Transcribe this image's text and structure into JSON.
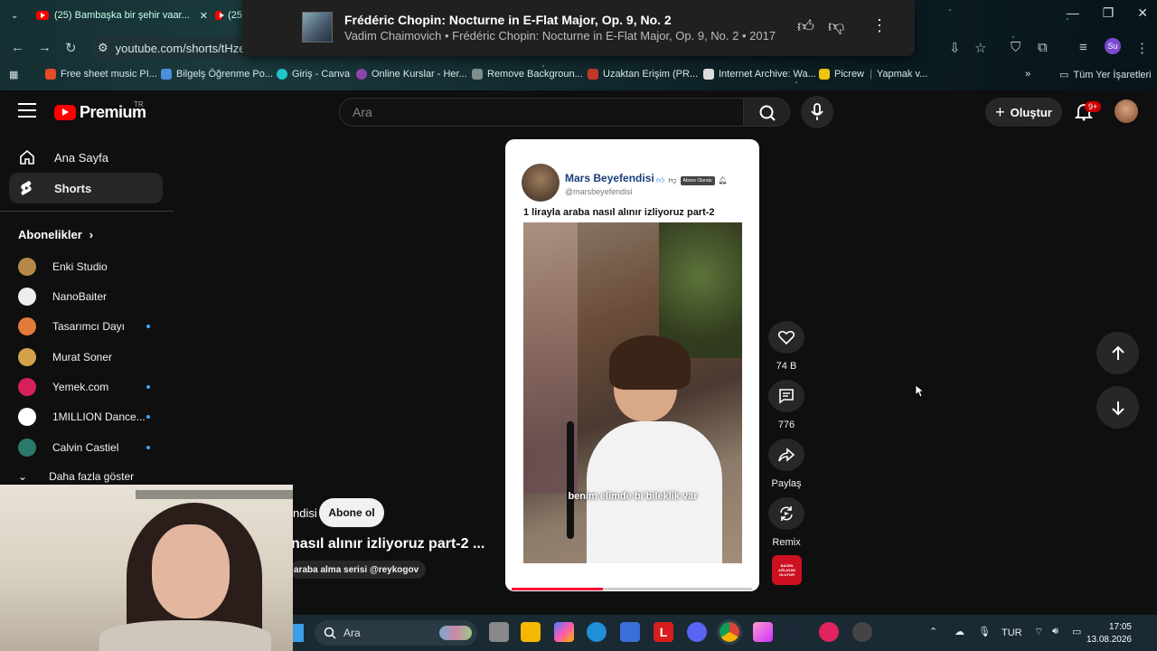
{
  "browser": {
    "tabs": [
      {
        "label": "(25) Bambaşka bir şehir vaar..."
      },
      {
        "label": "(25"
      }
    ],
    "address": "youtube.com/shorts/tHzeV",
    "profile_initials": "Su",
    "bookmarks": [
      {
        "label": "Free sheet music PI...",
        "color": "#e34c26"
      },
      {
        "label": "Bilgelş Öğrenme Po...",
        "color": "#4a90d9"
      },
      {
        "label": "Giriş - Canva",
        "color": "#20c4cb"
      },
      {
        "label": "Online Kurslar - Her...",
        "color": "#8e44ad"
      },
      {
        "label": "Remove Backgroun...",
        "color": "#7f8c8d"
      },
      {
        "label": "Uzaktan Erişim (PR...",
        "color": "#c0392b"
      },
      {
        "label": "Internet Archive: Wa...",
        "color": "#dddddd"
      },
      {
        "label": "Picrew",
        "color": "#f1c40f"
      },
      {
        "label": "Yapmak v...",
        "color": "#888888"
      }
    ],
    "all_bookmarks": "Tüm Yer İşaretleri"
  },
  "media": {
    "title": "Frédéric Chopin: Nocturne in E-Flat Major, Op. 9, No. 2",
    "subtitle": "Vadim Chaimovich • Frédéric Chopin: Nocturne in E-Flat Major, Op. 9, No. 2 • 2017"
  },
  "header": {
    "logo": "Premium",
    "logo_region": "TR",
    "search_placeholder": "Ara",
    "create_label": "Oluştur",
    "notif_badge": "9+"
  },
  "sidebar": {
    "items": [
      {
        "label": "Ana Sayfa"
      },
      {
        "label": "Shorts"
      }
    ],
    "subs_title": "Abonelikler",
    "subscriptions": [
      {
        "name": "Enki Studio",
        "color": "#b5884a",
        "new": false
      },
      {
        "name": "NanoBaiter",
        "color": "#eeeeee",
        "new": false
      },
      {
        "name": "Tasarımcı Dayı",
        "color": "#e07b39",
        "new": true
      },
      {
        "name": "Murat Soner",
        "color": "#d4a24a",
        "new": false
      },
      {
        "name": "Yemek.com",
        "color": "#d6215a",
        "new": true
      },
      {
        "name": "1MILLION Dance...",
        "color": "#ffffff",
        "new": true
      },
      {
        "name": "Calvin Castiel",
        "color": "#2a7a6a",
        "new": true
      }
    ],
    "more_label": "Daha fazla göster"
  },
  "short": {
    "post_name": "Mars Beyefendisi",
    "post_handle": "@marsbeyefendisi",
    "post_sub_label": "Abone Olundu",
    "post_caption": "1 lirayla araba nasıl alınır izliyoruz part-2",
    "video_subtitle": "benim elimde bi bileklik var",
    "progress": 0.38
  },
  "actions": {
    "like_count": "74 B",
    "comment_count": "776",
    "share_label": "Paylaş",
    "remix_label": "Remix",
    "sound_label": "BAZEN AĞLAYAN OLUYOR"
  },
  "overlay": {
    "channel_fragment": "ndisi",
    "subscribe_label": "Abone ol",
    "title_fragment": "nasıl alınır izliyoruz part-2 ...",
    "tag": "araba alma serisi @reykogov"
  },
  "taskbar": {
    "search_label": "Ara",
    "lang": "TUR",
    "time": "17:05",
    "date": "13.08.2026"
  }
}
